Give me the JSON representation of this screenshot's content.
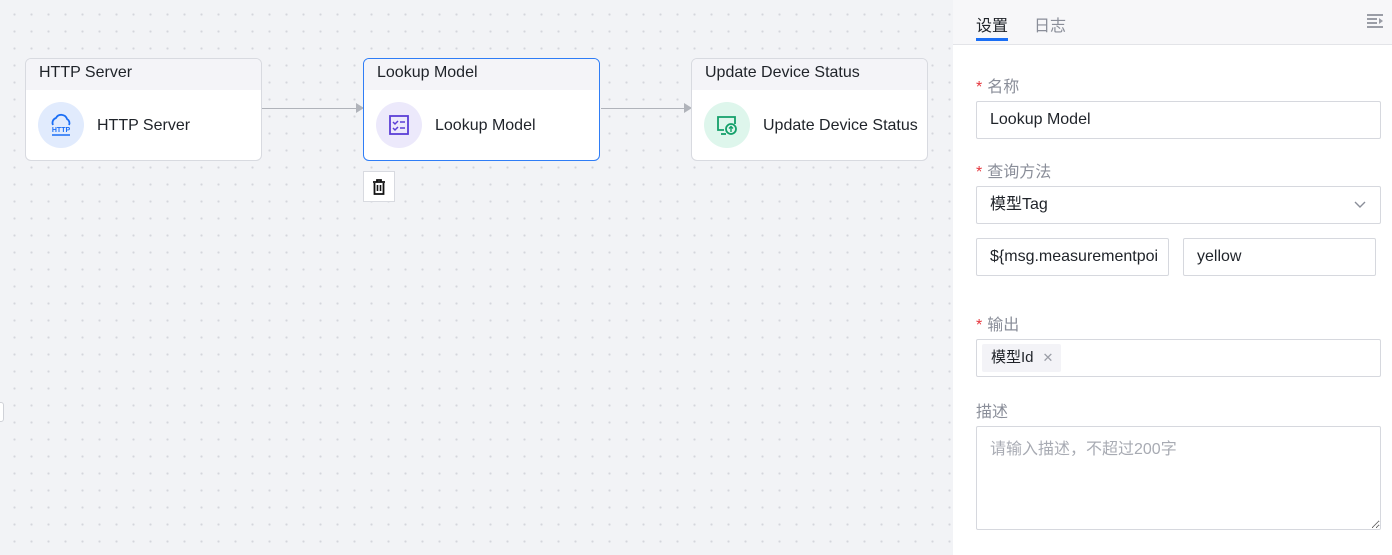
{
  "canvas": {
    "nodes": [
      {
        "title": "HTTP Server",
        "label": "HTTP Server",
        "icon": "http-cloud-icon",
        "icon_color": "#1a6ef5",
        "icon_bg": "#e1ebfd",
        "selected": false
      },
      {
        "title": "Lookup Model",
        "label": "Lookup Model",
        "icon": "checklist-icon",
        "icon_color": "#5b3fd6",
        "icon_bg": "#ece9fb",
        "selected": true
      },
      {
        "title": "Update Device Status",
        "label": "Update Device Status",
        "icon": "monitor-upload-icon",
        "icon_color": "#13a06a",
        "icon_bg": "#def6ec",
        "selected": false
      }
    ],
    "delete_icon": "trash-icon",
    "http_icon_text": "HTTP"
  },
  "panel": {
    "tabs": [
      {
        "label": "设置",
        "active": true
      },
      {
        "label": "日志",
        "active": false
      }
    ],
    "collapse_icon": "collapse-panel-icon",
    "name": {
      "label": "名称",
      "required": true,
      "value": "Lookup Model"
    },
    "method": {
      "label": "查询方法",
      "required": true,
      "value": "模型Tag"
    },
    "params": {
      "key": "${msg.measurementpoi",
      "value": "yellow"
    },
    "output": {
      "label": "输出",
      "required": true,
      "tags": [
        "模型Id"
      ]
    },
    "description": {
      "label": "描述",
      "placeholder": "请输入描述，不超过200字",
      "value": ""
    },
    "accent": "#1a6ef5",
    "required_color": "#e5363d"
  }
}
